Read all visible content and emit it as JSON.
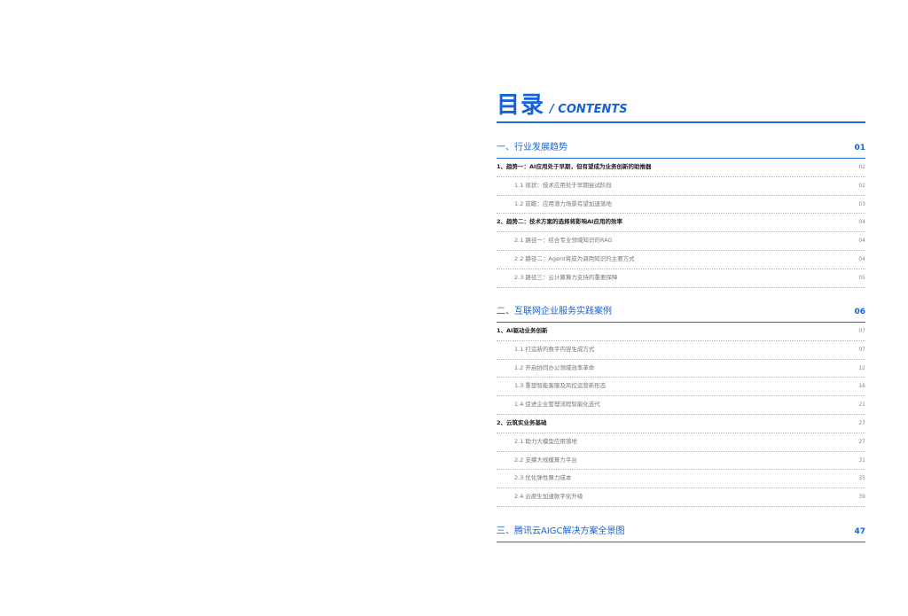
{
  "toc": {
    "title_cn": "目录",
    "title_en": "/ CONTENTS",
    "sections": [
      {
        "title": "一、行业发展趋势",
        "page": "01",
        "items": [
          {
            "level": 1,
            "title": "1、趋势一：AI应用处于早期，但有望成为业务创新的助推器",
            "page": "02"
          },
          {
            "level": 2,
            "title": "1.1 现状：技术应用处于早期尝试阶段",
            "page": "02"
          },
          {
            "level": 2,
            "title": "1.2 前瞻：应用潜力场景有望加速落地",
            "page": "03"
          },
          {
            "level": 1,
            "title": "2、趋势二：技术方案的选择将影响AI应用的效率",
            "page": "04"
          },
          {
            "level": 2,
            "title": "2.1 路径一：结合专业领域知识的RAG",
            "page": "04"
          },
          {
            "level": 2,
            "title": "2.2 路径二：Agent将成为调用知识的主要方式",
            "page": "04"
          },
          {
            "level": 2,
            "title": "2.3 路径三：云计算算力支持的重要保障",
            "page": "05"
          }
        ]
      },
      {
        "title": "二、互联网企业服务实践案例",
        "page": "06",
        "items": [
          {
            "level": 1,
            "title": "1、AI驱动业务创新",
            "page": "07"
          },
          {
            "level": 2,
            "title": "1.1 打造新的数字内容生成方式",
            "page": "07"
          },
          {
            "level": 2,
            "title": "1.2 开启协同办公领域效率革命",
            "page": "12"
          },
          {
            "level": 2,
            "title": "1.3 重塑智能客服及风控运营新形态",
            "page": "16"
          },
          {
            "level": 2,
            "title": "1.4 促进企业管理流程智能化迭代",
            "page": "21"
          },
          {
            "level": 1,
            "title": "2、云筑实业务基础",
            "page": "27"
          },
          {
            "level": 2,
            "title": "2.1 助力大模型应用落地",
            "page": "27"
          },
          {
            "level": 2,
            "title": "2.2 支撑大规模算力平台",
            "page": "31"
          },
          {
            "level": 2,
            "title": "2.3 优化弹性算力成本",
            "page": "35"
          },
          {
            "level": 2,
            "title": "2.4 云原生加速数字化升级",
            "page": "39"
          }
        ]
      },
      {
        "title": "三、腾讯云AIGC解决方案全景图",
        "page": "47",
        "items": []
      }
    ]
  }
}
